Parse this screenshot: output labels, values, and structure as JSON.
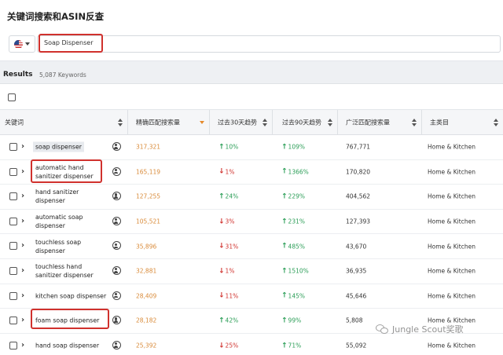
{
  "page_title": "关键词搜索和ASIN反查",
  "marketplace": {
    "icon": "us-flag-icon"
  },
  "search": {
    "value": "Soap Dispenser"
  },
  "results": {
    "label": "Results",
    "count": "5,087 Keywords"
  },
  "table": {
    "columns": [
      "关键词",
      "精确匹配搜索量",
      "过去30天趋势",
      "过去90天趋势",
      "广泛匹配搜索量",
      "主类目"
    ],
    "rows": [
      {
        "keyword": "soap dispenser",
        "exact": "317,321",
        "trend30": "10%",
        "trend30_dir": "up",
        "trend90": "109%",
        "trend90_dir": "up",
        "broad": "767,771",
        "category": "Home & Kitchen"
      },
      {
        "keyword": "automatic hand sanitizer dispenser",
        "exact": "165,119",
        "trend30": "1%",
        "trend30_dir": "down",
        "trend90": "1366%",
        "trend90_dir": "up",
        "broad": "170,820",
        "category": "Home & Kitchen"
      },
      {
        "keyword": "hand sanitizer dispenser",
        "exact": "127,255",
        "trend30": "24%",
        "trend30_dir": "up",
        "trend90": "229%",
        "trend90_dir": "up",
        "broad": "404,562",
        "category": "Home & Kitchen"
      },
      {
        "keyword": "automatic soap dispenser",
        "exact": "105,521",
        "trend30": "3%",
        "trend30_dir": "down",
        "trend90": "231%",
        "trend90_dir": "up",
        "broad": "127,393",
        "category": "Home & Kitchen"
      },
      {
        "keyword": "touchless soap dispenser",
        "exact": "35,896",
        "trend30": "31%",
        "trend30_dir": "down",
        "trend90": "485%",
        "trend90_dir": "up",
        "broad": "43,670",
        "category": "Home & Kitchen"
      },
      {
        "keyword": "touchless hand sanitizer dispenser",
        "exact": "32,881",
        "trend30": "1%",
        "trend30_dir": "down",
        "trend90": "1510%",
        "trend90_dir": "up",
        "broad": "36,935",
        "category": "Home & Kitchen"
      },
      {
        "keyword": "kitchen soap dispenser",
        "exact": "28,409",
        "trend30": "11%",
        "trend30_dir": "down",
        "trend90": "145%",
        "trend90_dir": "up",
        "broad": "45,646",
        "category": "Home & Kitchen"
      },
      {
        "keyword": "foam soap dispenser",
        "exact": "28,182",
        "trend30": "42%",
        "trend30_dir": "up",
        "trend90": "99%",
        "trend90_dir": "up",
        "broad": "5,808",
        "category": "Home & Kitchen"
      },
      {
        "keyword": "hand soap dispenser",
        "exact": "25,392",
        "trend30": "25%",
        "trend30_dir": "down",
        "trend90": "71%",
        "trend90_dir": "up",
        "broad": "55,092",
        "category": "Home & Kitchen"
      }
    ]
  },
  "watermark": {
    "text": "Jungle Scout奖歌"
  },
  "colors": {
    "highlight_box": "#d0312d",
    "trend_up": "#2a9d56",
    "trend_down": "#d0312d",
    "exact_volume": "#d98b3a"
  }
}
